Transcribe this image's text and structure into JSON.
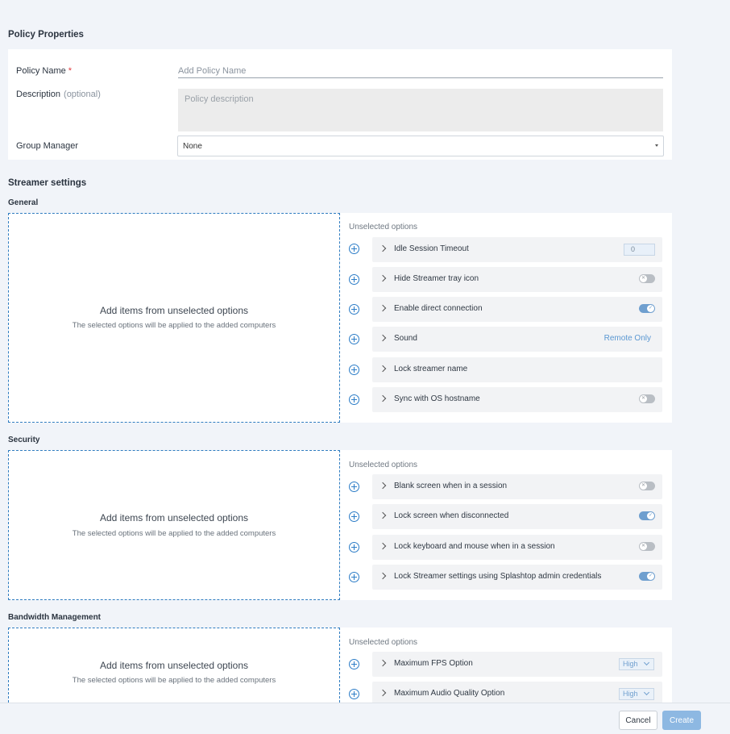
{
  "policy_properties": {
    "title": "Policy Properties",
    "policy_name_label": "Policy Name",
    "policy_name_required": "*",
    "policy_name_placeholder": "Add Policy Name",
    "description_label": "Description",
    "description_optional": "(optional)",
    "description_placeholder": "Policy description",
    "group_manager_label": "Group Manager",
    "group_manager_value": "None"
  },
  "streamer_settings": {
    "title": "Streamer settings"
  },
  "dropzone": {
    "title": "Add items from unselected options",
    "subtitle": "The selected options will be applied to the added computers"
  },
  "unselected_label": "Unselected options",
  "general": {
    "title": "General",
    "options": [
      {
        "label": "Idle Session Timeout",
        "control": "number",
        "value": "0"
      },
      {
        "label": "Hide Streamer tray icon",
        "control": "toggle",
        "state": "off"
      },
      {
        "label": "Enable direct connection",
        "control": "toggle",
        "state": "on"
      },
      {
        "label": "Sound",
        "control": "link",
        "value": "Remote Only"
      },
      {
        "label": "Lock streamer name",
        "control": "none"
      },
      {
        "label": "Sync with OS hostname",
        "control": "toggle",
        "state": "off"
      }
    ]
  },
  "security": {
    "title": "Security",
    "options": [
      {
        "label": "Blank screen when in a session",
        "control": "toggle",
        "state": "off"
      },
      {
        "label": "Lock screen when disconnected",
        "control": "toggle",
        "state": "on"
      },
      {
        "label": "Lock keyboard and mouse when in a session",
        "control": "toggle",
        "state": "off"
      },
      {
        "label": "Lock Streamer settings using Splashtop admin credentials",
        "control": "toggle",
        "state": "on"
      }
    ]
  },
  "bandwidth": {
    "title": "Bandwidth Management",
    "options": [
      {
        "label": "Maximum FPS Option",
        "control": "select",
        "value": "High"
      },
      {
        "label": "Maximum Audio Quality Option",
        "control": "select",
        "value": "High"
      }
    ]
  },
  "footer": {
    "cancel_label": "Cancel",
    "create_label": "Create"
  },
  "colors": {
    "accent": "#2b7cc7",
    "toggle_on": "#6f9fcf",
    "toggle_off": "#b9bec4",
    "create_button": "#8db8e2",
    "background": "#f1f4f9"
  }
}
